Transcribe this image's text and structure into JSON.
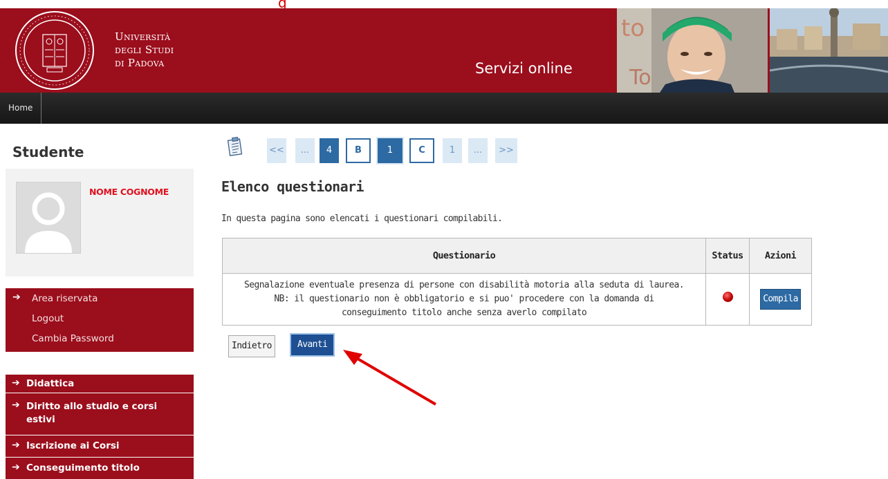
{
  "annotation": {
    "top_cropped_text": "g"
  },
  "header": {
    "university_lines": [
      "Università",
      "degli Studi",
      "di Padova"
    ],
    "service_title": "Servizi online",
    "colors": {
      "brand_red": "#9b0e1c",
      "nav_dark": "#1e1e1e",
      "accent_blue": "#2d6aa3"
    }
  },
  "nav": {
    "home_label": "Home"
  },
  "sidebar": {
    "title": "Studente",
    "user_name": "NOME COGNOME",
    "area": {
      "title": "Area riservata",
      "links": [
        "Logout",
        "Cambia Password"
      ]
    },
    "menu": [
      {
        "label": "Didattica"
      },
      {
        "label": "Diritto allo studio e corsi estivi"
      },
      {
        "label": "Iscrizione ai Corsi"
      },
      {
        "label": "Conseguimento titolo"
      }
    ]
  },
  "pager": {
    "items": [
      {
        "label": "<<"
      },
      {
        "label": "..."
      },
      {
        "label": "4"
      },
      {
        "label": "B"
      },
      {
        "label": "1"
      },
      {
        "label": "C"
      },
      {
        "label": "1"
      },
      {
        "label": "..."
      },
      {
        "label": ">>"
      }
    ]
  },
  "main": {
    "title": "Elenco questionari",
    "description": "In questa pagina sono elencati i questionari compilabili.",
    "table": {
      "headers": [
        "Questionario",
        "Status",
        "Azioni"
      ],
      "rows": [
        {
          "questionario_lines": [
            "Segnalazione eventuale presenza di persone con disabilità motoria alla seduta di laurea.",
            "NB: il questionario non è obbligatorio e si puo' procedere con la domanda di",
            "conseguimento titolo anche senza averlo compilato"
          ],
          "status": "red",
          "action_label": "Compila"
        }
      ]
    },
    "back_label": "Indietro",
    "next_label": "Avanti"
  }
}
